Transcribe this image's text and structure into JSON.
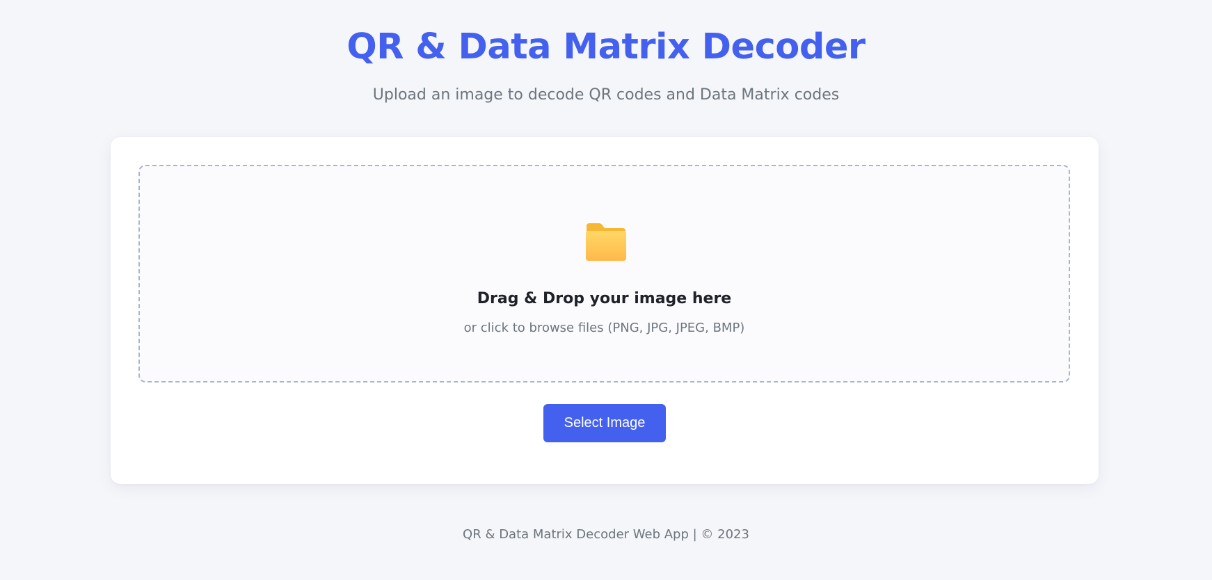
{
  "header": {
    "title": "QR & Data Matrix Decoder",
    "subtitle": "Upload an image to decode QR codes and Data Matrix codes"
  },
  "upload": {
    "icon": "folder-icon",
    "heading": "Drag & Drop your image here",
    "hint": "or click to browse files (PNG, JPG, JPEG, BMP)",
    "button_label": "Select Image"
  },
  "footer": {
    "text": "QR & Data Matrix Decoder Web App | © 2023"
  },
  "colors": {
    "accent": "#4361ee",
    "background": "#f5f6fa",
    "folder": "#ffc94d"
  }
}
